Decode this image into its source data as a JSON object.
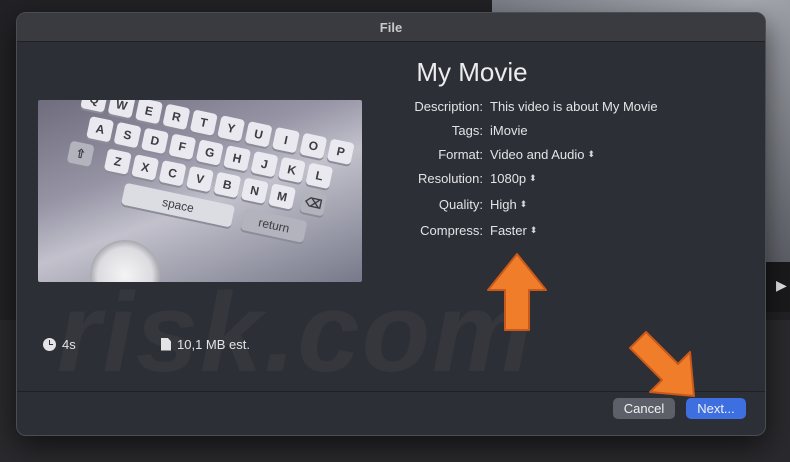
{
  "dialog": {
    "window_title": "File",
    "movie_title": "My Movie"
  },
  "form": {
    "description_label": "Description:",
    "description_value": "This video is about My Movie",
    "tags_label": "Tags:",
    "tags_value": "iMovie",
    "format_label": "Format:",
    "format_value": "Video and Audio",
    "resolution_label": "Resolution:",
    "resolution_value": "1080p",
    "quality_label": "Quality:",
    "quality_value": "High",
    "compress_label": "Compress:",
    "compress_value": "Faster"
  },
  "meta": {
    "duration": "4s",
    "size_estimate": "10,1 MB est."
  },
  "buttons": {
    "cancel": "Cancel",
    "next": "Next..."
  },
  "preview": {
    "keys_row1": [
      "Q",
      "W",
      "E",
      "R",
      "T",
      "Y",
      "U",
      "I",
      "O",
      "P"
    ],
    "keys_row2": [
      "A",
      "S",
      "D",
      "F",
      "G",
      "H",
      "J",
      "K",
      "L"
    ],
    "keys_row3": [
      "Z",
      "X",
      "C",
      "V",
      "B",
      "N",
      "M"
    ],
    "space_label": "space",
    "return_label": "return"
  },
  "watermark": "risk.com",
  "colors": {
    "accent": "#3d6fe0",
    "annotation_arrow": "#f07d2a"
  }
}
